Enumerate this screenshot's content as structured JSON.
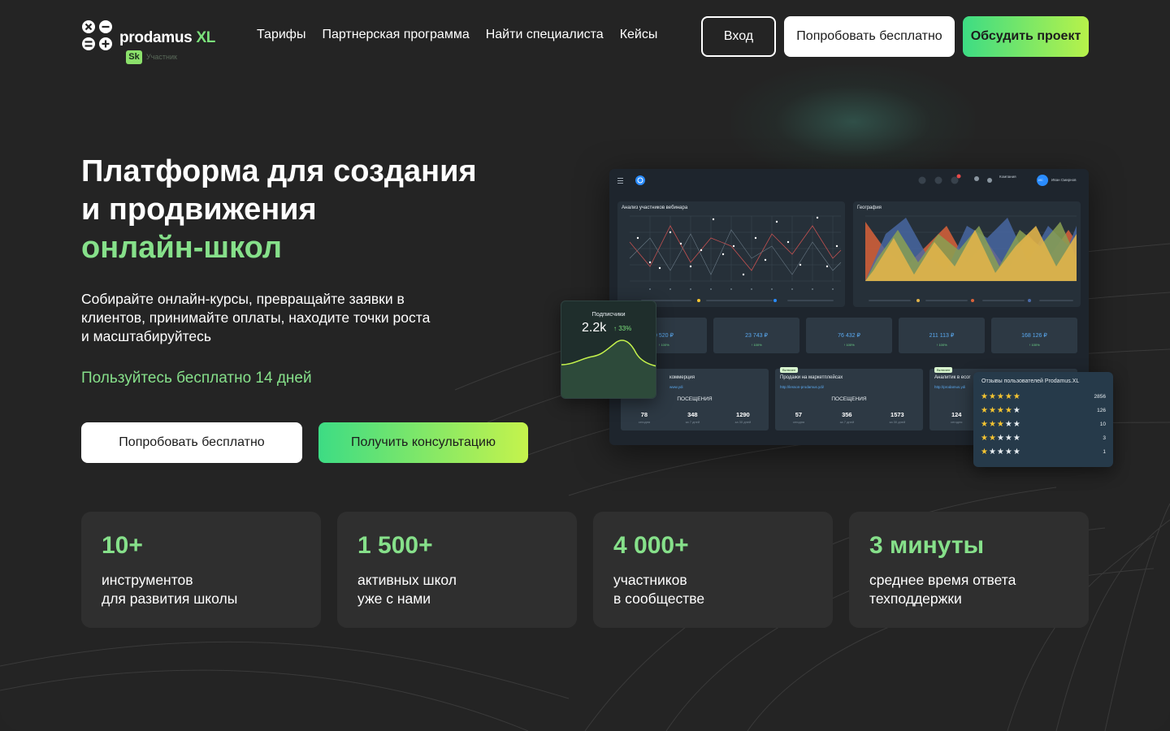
{
  "brand": {
    "name": "prodamus",
    "suffix": "XL",
    "badge": "Sk",
    "badge_caption": "Участник",
    "accent_color": "#86e08a"
  },
  "nav": {
    "items": [
      {
        "label": "Тарифы"
      },
      {
        "label": "Партнерская программа"
      },
      {
        "label": "Найти специалиста"
      },
      {
        "label": "Кейсы"
      }
    ]
  },
  "header_actions": {
    "login": "Вход",
    "try_free": "Попробовать бесплатно",
    "discuss": "Обсудить проект"
  },
  "hero": {
    "title_line1": "Платформа для создания",
    "title_line2": "и продвижения",
    "title_accent": "онлайн-школ",
    "description": "Собирайте онлайн-курсы, превращайте заявки в клиентов, принимайте оплаты, находите точки роста и масштабируйтесь",
    "free_note": "Пользуйтесь бесплатно 14 дней",
    "cta_try": "Попробовать бесплатно",
    "cta_consult": "Получить консультацию"
  },
  "dashboard": {
    "panel_webinar": "Анализ участников вебинара",
    "panel_geo": "География",
    "user_company": "Компания",
    "user_name": "Иван Смирнов",
    "avatar_initials": "ИС",
    "kpis": [
      {
        "value": "0 520 ₽",
        "pct": "↑ 100%"
      },
      {
        "value": "23 743 ₽",
        "pct": "↑ 100%"
      },
      {
        "value": "76 432 ₽",
        "pct": "↑ 100%"
      },
      {
        "value": "211 113 ₽",
        "pct": "↑ 100%"
      },
      {
        "value": "168 126 ₽",
        "pct": "↑ 100%"
      }
    ],
    "visits": [
      {
        "tag": "",
        "title": "коммерция",
        "link": "www.ydi",
        "head": "ПОСЕЩЕНИЯ",
        "nums": [
          {
            "n": "78",
            "l": "сегодня"
          },
          {
            "n": "348",
            "l": "за 7 дней"
          },
          {
            "n": "1290",
            "l": "за 30 дней"
          }
        ]
      },
      {
        "tag": "Включен",
        "title": "Продажи на маркетплейсах",
        "link": "http://lesson-prodamus.ydi/",
        "head": "ПОСЕЩЕНИЯ",
        "nums": [
          {
            "n": "57",
            "l": "сегодня"
          },
          {
            "n": "356",
            "l": "за 7 дней"
          },
          {
            "n": "1573",
            "l": "за 30 дней"
          }
        ]
      },
      {
        "tag": "Включен",
        "title": "Аналитик в ecor",
        "link": "http://prodamus.ydi",
        "head": "",
        "nums": [
          {
            "n": "124",
            "l": "сегодня"
          }
        ]
      }
    ],
    "subscribers": {
      "label": "Подписчики",
      "value": "2.2k",
      "pct": "↑ 33%"
    },
    "reviews": {
      "title": "Отзывы пользователей Prodamus.XL",
      "rows": [
        {
          "stars": 5,
          "count": "2856"
        },
        {
          "stars": 4,
          "count": "126"
        },
        {
          "stars": 3,
          "count": "10"
        },
        {
          "stars": 2,
          "count": "3"
        },
        {
          "stars": 1,
          "count": "1"
        }
      ]
    }
  },
  "stats": [
    {
      "value": "10+",
      "line1": "инструментов",
      "line2": "для развития школы"
    },
    {
      "value": "1 500+",
      "line1": "активных школ",
      "line2": "уже с нами"
    },
    {
      "value": "4 000+",
      "line1": "участников",
      "line2": "в сообществе"
    },
    {
      "value": "3 минуты",
      "line1": "среднее время ответа",
      "line2": "техподдержки"
    }
  ]
}
